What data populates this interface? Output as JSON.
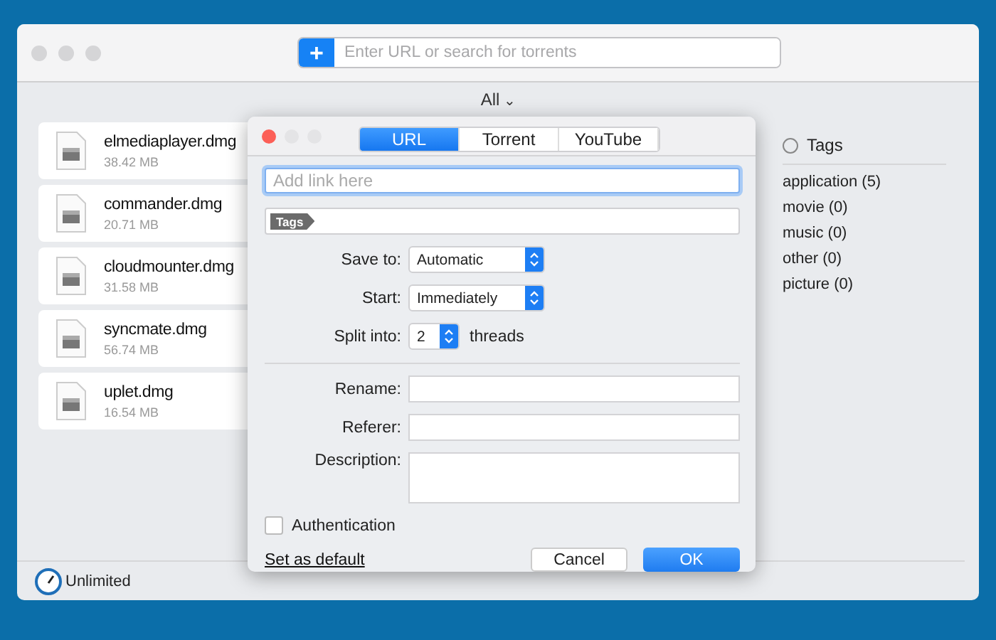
{
  "toolbar": {
    "add_label": "+",
    "search": {
      "placeholder": "Enter URL or search for torrents"
    }
  },
  "filter": {
    "label": "All",
    "caret": "⌄"
  },
  "downloads": [
    {
      "name": "elmediaplayer.dmg",
      "size": "38.42 MB"
    },
    {
      "name": "commander.dmg",
      "size": "20.71 MB"
    },
    {
      "name": "cloudmounter.dmg",
      "size": "31.58 MB"
    },
    {
      "name": "syncmate.dmg",
      "size": "56.74 MB"
    },
    {
      "name": "uplet.dmg",
      "size": "16.54 MB"
    }
  ],
  "tags_panel": {
    "title": "Tags",
    "items": [
      "application (5)",
      "movie (0)",
      "music (0)",
      "other (0)",
      "picture (0)"
    ]
  },
  "status_bar": {
    "speed": "Unlimited"
  },
  "dialog": {
    "tabs": [
      {
        "label": "URL",
        "selected": true
      },
      {
        "label": "Torrent",
        "selected": false
      },
      {
        "label": "YouTube",
        "selected": false
      }
    ],
    "link": {
      "placeholder": "Add link here"
    },
    "tags_label": "Tags",
    "save_to": {
      "label": "Save to:",
      "value": "Automatic"
    },
    "start": {
      "label": "Start:",
      "value": "Immediately"
    },
    "split": {
      "label": "Split into:",
      "value": "2",
      "unit": "threads"
    },
    "fields": [
      {
        "label": "Rename:",
        "kind": "line"
      },
      {
        "label": "Referer:",
        "kind": "line"
      },
      {
        "label": "Description:",
        "kind": "area"
      }
    ],
    "authentication": {
      "label": "Authentication",
      "checked": false
    },
    "default_link": "Set as default",
    "buttons": [
      {
        "label": "Cancel",
        "kind": "secondary"
      },
      {
        "label": "OK",
        "kind": "primary"
      }
    ]
  }
}
